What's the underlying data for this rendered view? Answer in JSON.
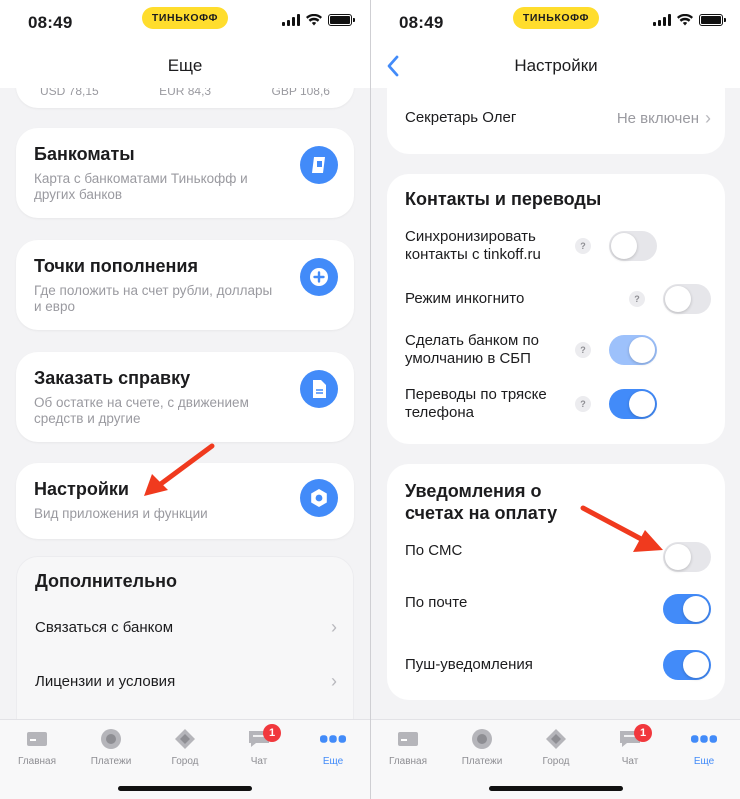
{
  "status": {
    "time": "08:49",
    "brand": "ТИНЬКОФФ"
  },
  "left": {
    "title": "Еще",
    "rates": [
      "USD 78,15",
      "EUR 84,3",
      "GBP 108,6"
    ],
    "cards": [
      {
        "title": "Банкоматы",
        "subtitle": "Карта с банкоматами Тинькофф и других банков",
        "icon": "atm-icon"
      },
      {
        "title": "Точки пополнения",
        "subtitle": "Где положить на счет рубли, доллары и евро",
        "icon": "plus-icon"
      },
      {
        "title": "Заказать справку",
        "subtitle": "Об остатке на счете, с движением средств и другие",
        "icon": "document-icon"
      },
      {
        "title": "Настройки",
        "subtitle": "Вид приложения и функции",
        "icon": "gear-icon"
      }
    ],
    "extra": {
      "title": "Дополнительно",
      "items": [
        "Связаться с банком",
        "Лицензии и условия"
      ]
    }
  },
  "right": {
    "title": "Настройки",
    "secretary": {
      "label": "Секретарь Олег",
      "value": "Не включен"
    },
    "contacts": {
      "title": "Контакты и переводы",
      "rows": [
        {
          "label": "Синхронизировать контакты с tinkoff.ru",
          "state": "off"
        },
        {
          "label": "Режим инкогнито",
          "state": "off"
        },
        {
          "label": "Сделать банком по умолчанию в СБП",
          "state": "on-disabled"
        },
        {
          "label": "Переводы по тряске телефона",
          "state": "on"
        }
      ]
    },
    "notifications": {
      "title": "Уведомления о счетах на оплату",
      "rows": [
        {
          "label": "По СМС",
          "state": "off"
        },
        {
          "label": "По почте",
          "state": "on"
        },
        {
          "label": "Пуш-уведомления",
          "state": "on"
        }
      ]
    }
  },
  "tabbar": {
    "items": [
      {
        "label": "Главная",
        "icon": "home-card-icon"
      },
      {
        "label": "Платежи",
        "icon": "payments-circle-icon"
      },
      {
        "label": "Город",
        "icon": "city-diamond-icon"
      },
      {
        "label": "Чат",
        "icon": "chat-icon",
        "badge": "1"
      },
      {
        "label": "Еще",
        "icon": "more-dots-icon",
        "active": true
      }
    ]
  },
  "colors": {
    "accent": "#428BF9",
    "brand": "#FFDD2D",
    "badge": "#F1383D",
    "annotation": "#F03A1E"
  }
}
